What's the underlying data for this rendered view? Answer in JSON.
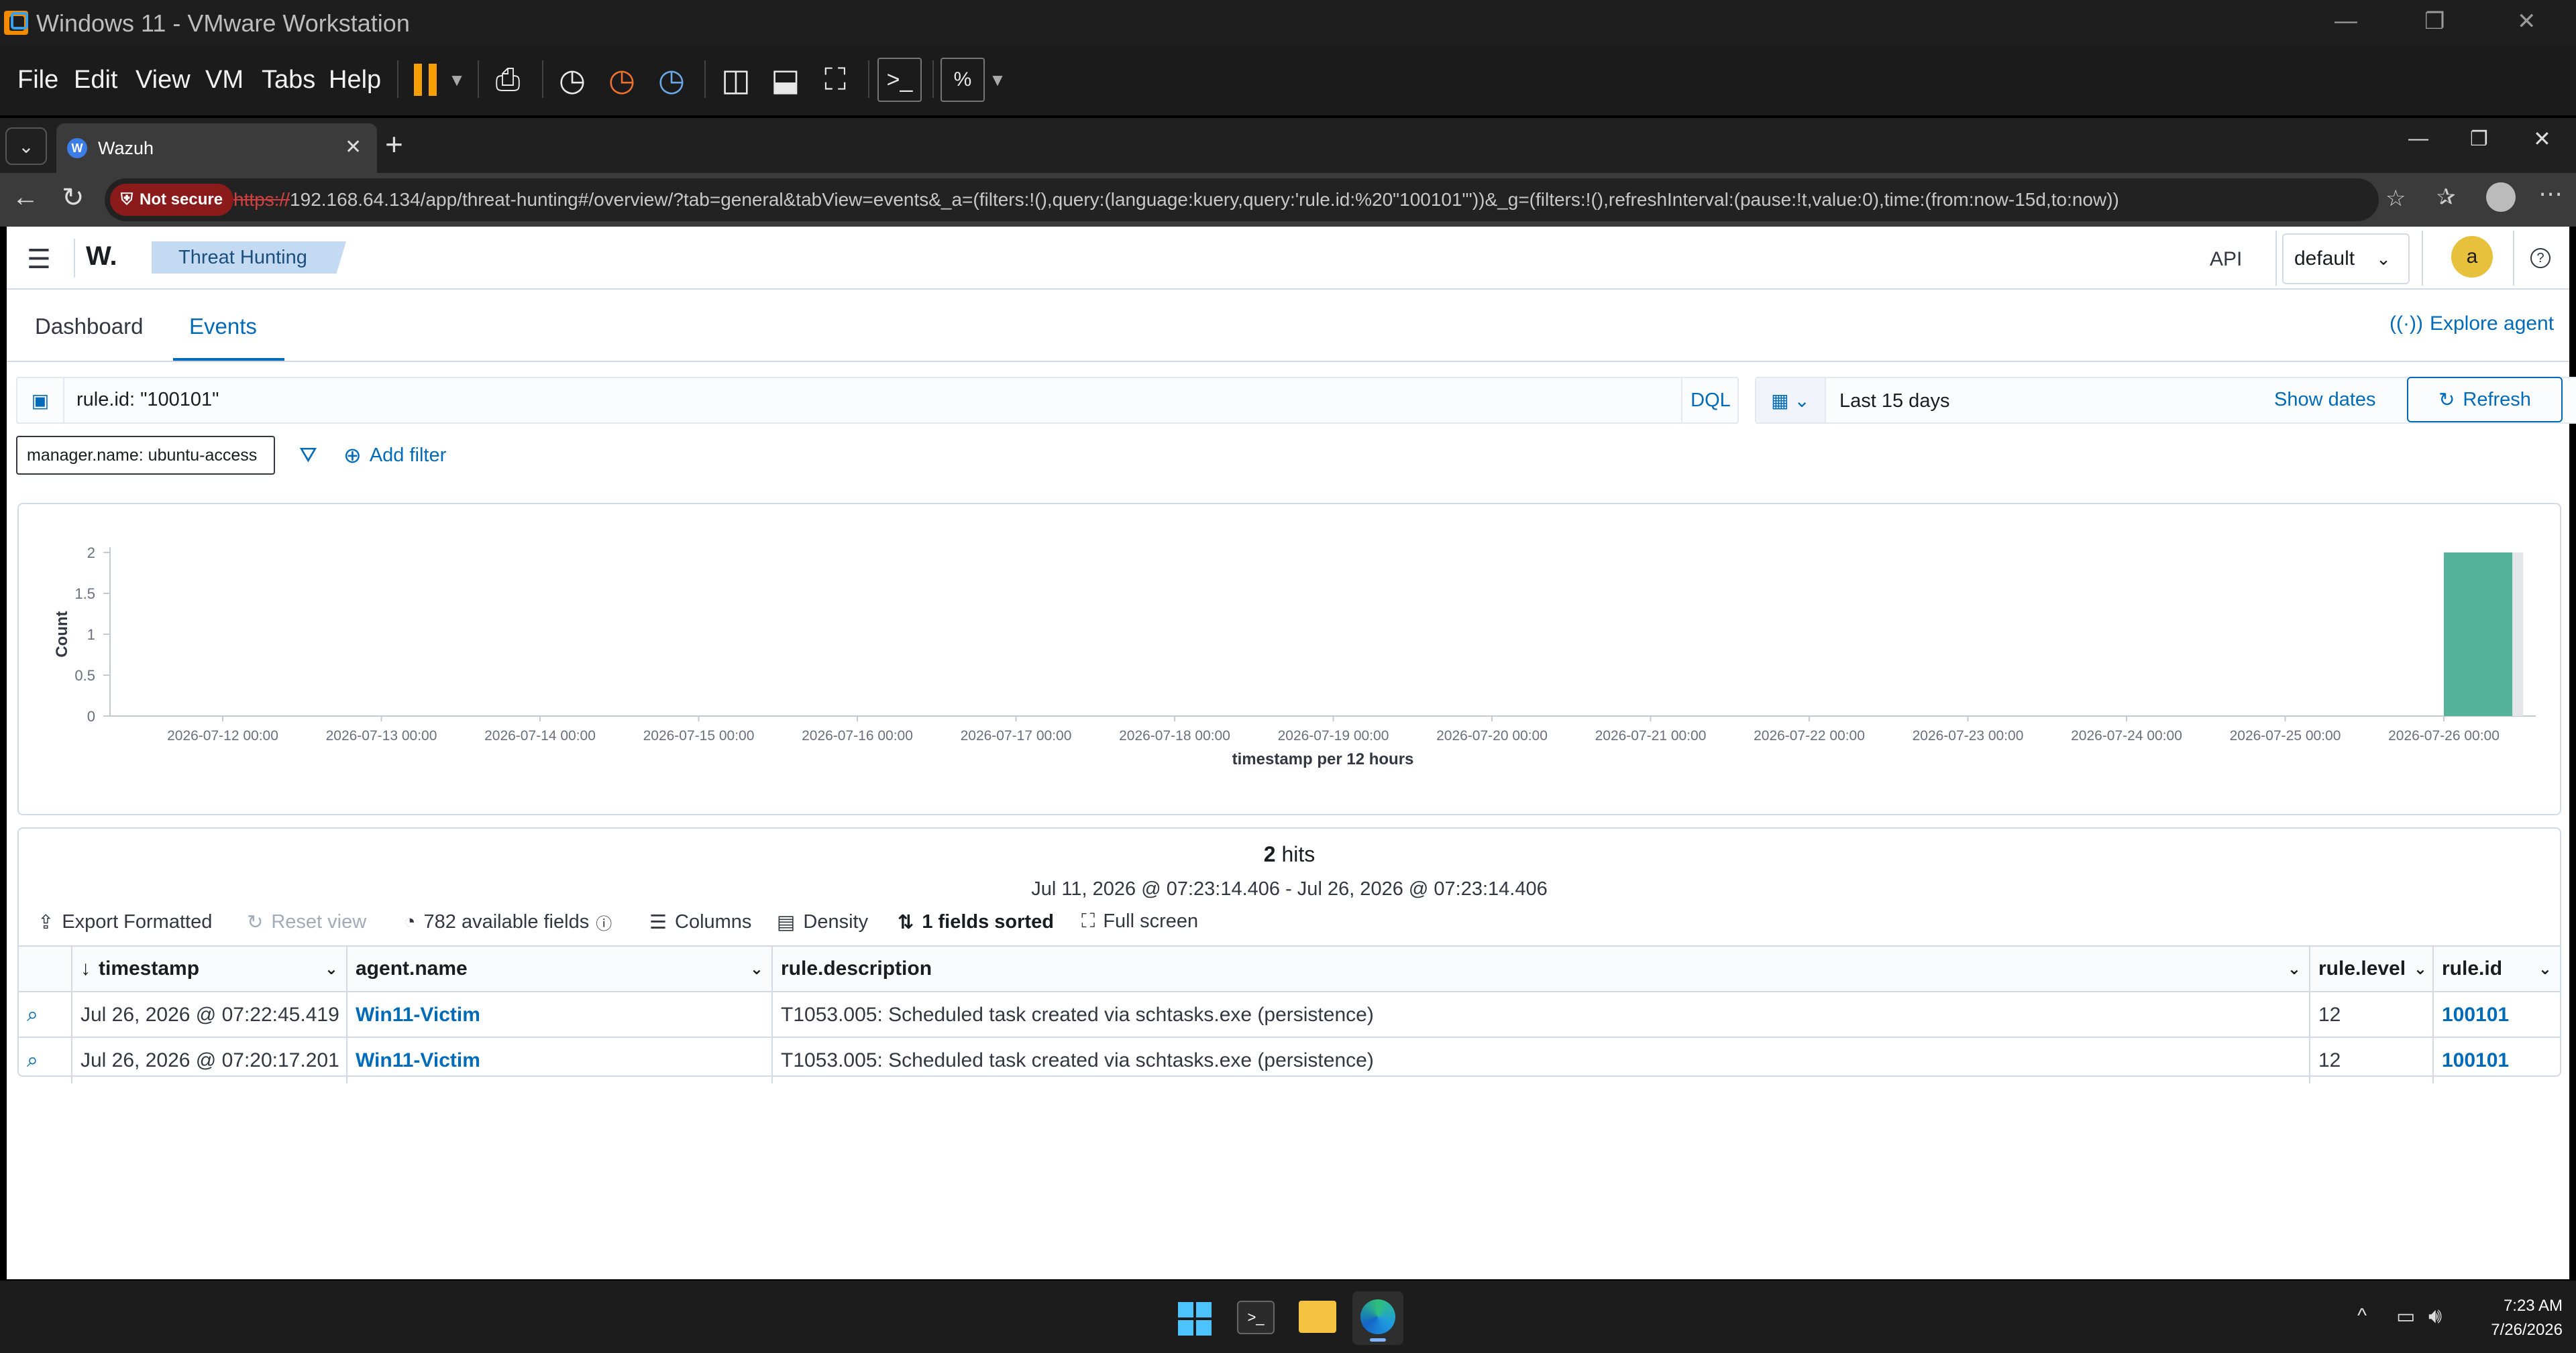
{
  "vmware": {
    "window_title": "Windows 11 - VMware Workstation",
    "menus": [
      "File",
      "Edit",
      "View",
      "VM",
      "Tabs",
      "Help"
    ]
  },
  "browser": {
    "tab_title": "Wazuh",
    "not_secure": "Not secure",
    "url_scheme": "https://",
    "url_rest": "192.168.64.134/app/threat-hunting#/overview/?tab=general&tabView=events&_a=(filters:!(),query:(language:kuery,query:'rule.id:%20\"100101\"'))&_g=(filters:!(),refreshInterval:(pause:!t,value:0),time:(from:now-15d,to:now))"
  },
  "header": {
    "logo": "W.",
    "breadcrumb": "Threat Hunting",
    "api_label": "API",
    "api_select": "default",
    "avatar_initial": "a"
  },
  "tabs": {
    "dashboard": "Dashboard",
    "events": "Events",
    "explore_agent": "Explore agent"
  },
  "search": {
    "query": "rule.id: \"100101\"",
    "dql": "DQL",
    "date_range": "Last 15 days",
    "show_dates": "Show dates",
    "refresh": "Refresh"
  },
  "filters": {
    "pill": "manager.name: ubuntu-access",
    "add_filter": "Add filter"
  },
  "chart_data": {
    "type": "bar",
    "xlabel": "timestamp per 12 hours",
    "ylabel": "Count",
    "y_ticks": [
      "2",
      "1.5",
      "1",
      "0.5",
      "0"
    ],
    "ylim": [
      0,
      2
    ],
    "x_ticks": [
      "2026-07-12 00:00",
      "2026-07-13 00:00",
      "2026-07-14 00:00",
      "2026-07-15 00:00",
      "2026-07-16 00:00",
      "2026-07-17 00:00",
      "2026-07-18 00:00",
      "2026-07-19 00:00",
      "2026-07-20 00:00",
      "2026-07-21 00:00",
      "2026-07-22 00:00",
      "2026-07-23 00:00",
      "2026-07-24 00:00",
      "2026-07-25 00:00",
      "2026-07-26 00:00"
    ],
    "bars": [
      {
        "x": "2026-07-26 00:00",
        "value": 2
      }
    ],
    "bar_color": "#54b399",
    "grid": false
  },
  "results": {
    "hits_count": "2",
    "hits_label": "hits",
    "time_range": "Jul 11, 2026 @ 07:23:14.406 - Jul 26, 2026 @ 07:23:14.406",
    "toolbar": {
      "export": "Export Formatted",
      "reset": "Reset view",
      "fields": "782 available fields",
      "columns": "Columns",
      "density": "Density",
      "sorted": "1 fields sorted",
      "fullscreen": "Full screen"
    },
    "columns": [
      "timestamp",
      "agent.name",
      "rule.description",
      "rule.level",
      "rule.id"
    ],
    "rows": [
      {
        "timestamp": "Jul 26, 2026 @ 07:22:45.419",
        "agent": "Win11-Victim",
        "description": "T1053.005: Scheduled task created via schtasks.exe (persistence)",
        "level": "12",
        "rule_id": "100101"
      },
      {
        "timestamp": "Jul 26, 2026 @ 07:20:17.201",
        "agent": "Win11-Victim",
        "description": "T1053.005: Scheduled task created via schtasks.exe (persistence)",
        "level": "12",
        "rule_id": "100101"
      }
    ]
  },
  "taskbar": {
    "time": "7:23 AM",
    "date": "7/26/2026"
  }
}
